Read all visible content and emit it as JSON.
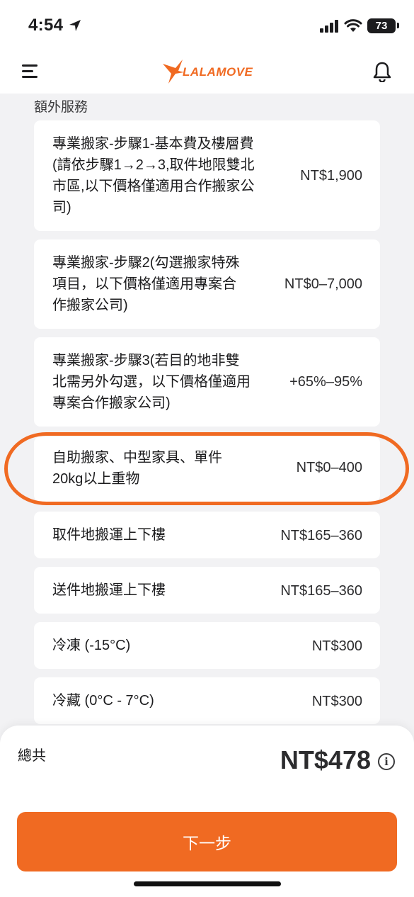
{
  "status_bar": {
    "time": "4:54",
    "battery": "73"
  },
  "header": {
    "brand": "LALAMOVE"
  },
  "section_title": "額外服務",
  "services": [
    {
      "label_lines": [
        "專業搬家-步驟1-基本費及樓層費",
        "(請依步驟1→2→3,取件地限雙北",
        "市區,以下價格僅適用合作搬家公",
        "司)"
      ],
      "price": "NT$1,900"
    },
    {
      "label_lines": [
        "專業搬家-步驟2(勾選搬家特殊",
        "項目，以下價格僅適用專案合",
        "作搬家公司)"
      ],
      "price": "NT$0–7,000"
    },
    {
      "label_lines": [
        "專業搬家-步驟3(若目的地非雙",
        "北需另外勾選，以下價格僅適用",
        "專案合作搬家公司)"
      ],
      "price": "+65%–95%"
    },
    {
      "label_lines": [
        "自助搬家、中型家具、單件",
        "20kg以上重物"
      ],
      "price": "NT$0–400",
      "highlighted": true
    },
    {
      "label_lines": [
        "取件地搬運上下樓"
      ],
      "price": "NT$165–360"
    },
    {
      "label_lines": [
        "送件地搬運上下樓"
      ],
      "price": "NT$165–360"
    },
    {
      "label_lines": [
        "冷凍 (-15°C)"
      ],
      "price": "NT$300"
    },
    {
      "label_lines": [
        "冷藏 (0°C - 7°C)"
      ],
      "price": "NT$300"
    }
  ],
  "footer": {
    "total_label": "總共",
    "total_amount": "NT$478",
    "info_glyph": "i",
    "next_label": "下一步"
  },
  "colors": {
    "accent": "#f06a22",
    "background": "#f2f2f4"
  }
}
